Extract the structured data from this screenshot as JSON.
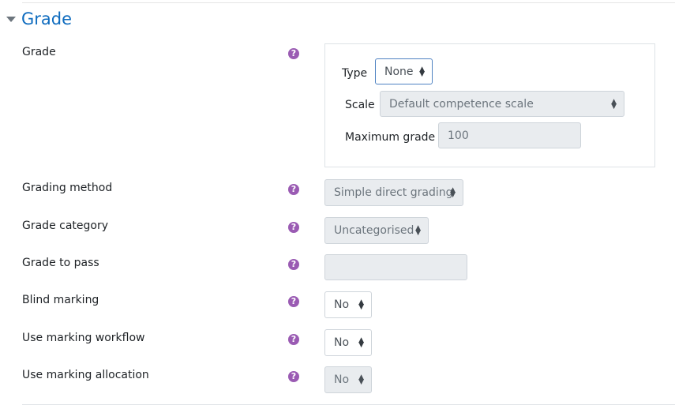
{
  "section": {
    "title": "Grade"
  },
  "grade": {
    "label": "Grade",
    "type_label": "Type",
    "type_value": "None",
    "scale_label": "Scale",
    "scale_value": "Default competence scale",
    "max_label": "Maximum grade",
    "max_value": "100"
  },
  "rows": {
    "grading_method": {
      "label": "Grading method",
      "value": "Simple direct grading"
    },
    "grade_category": {
      "label": "Grade category",
      "value": "Uncategorised"
    },
    "grade_to_pass": {
      "label": "Grade to pass",
      "value": ""
    },
    "blind_marking": {
      "label": "Blind marking",
      "value": "No"
    },
    "marking_workflow": {
      "label": "Use marking workflow",
      "value": "No"
    },
    "marking_allocation": {
      "label": "Use marking allocation",
      "value": "No"
    }
  },
  "help_glyph": "?",
  "icons": {
    "help": "question-circle-icon",
    "collapse": "caret-down-icon",
    "select_arrows": "sort-arrows-icon"
  },
  "colors": {
    "accent": "#0f6cbf",
    "help": "#9a5bb3",
    "disabled_bg": "#e9ecef"
  }
}
